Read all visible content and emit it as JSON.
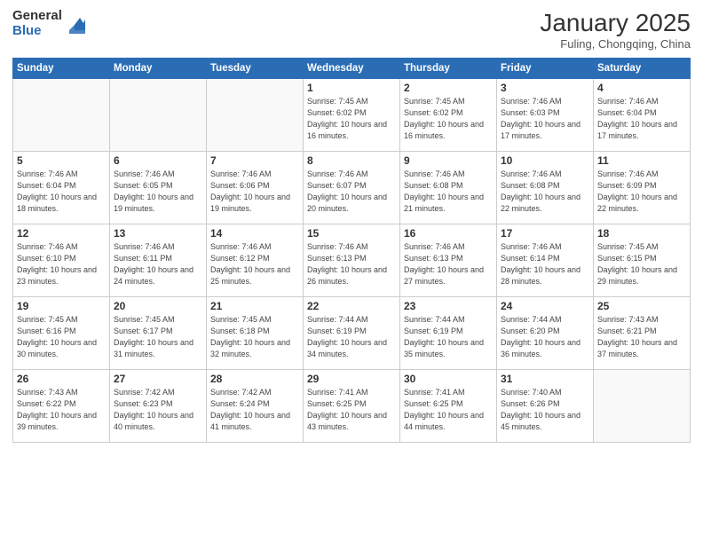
{
  "logo": {
    "general": "General",
    "blue": "Blue"
  },
  "header": {
    "month": "January 2025",
    "location": "Fuling, Chongqing, China"
  },
  "weekdays": [
    "Sunday",
    "Monday",
    "Tuesday",
    "Wednesday",
    "Thursday",
    "Friday",
    "Saturday"
  ],
  "weeks": [
    [
      {
        "day": "",
        "sunrise": "",
        "sunset": "",
        "daylight": ""
      },
      {
        "day": "",
        "sunrise": "",
        "sunset": "",
        "daylight": ""
      },
      {
        "day": "",
        "sunrise": "",
        "sunset": "",
        "daylight": ""
      },
      {
        "day": "1",
        "sunrise": "Sunrise: 7:45 AM",
        "sunset": "Sunset: 6:02 PM",
        "daylight": "Daylight: 10 hours and 16 minutes."
      },
      {
        "day": "2",
        "sunrise": "Sunrise: 7:45 AM",
        "sunset": "Sunset: 6:02 PM",
        "daylight": "Daylight: 10 hours and 16 minutes."
      },
      {
        "day": "3",
        "sunrise": "Sunrise: 7:46 AM",
        "sunset": "Sunset: 6:03 PM",
        "daylight": "Daylight: 10 hours and 17 minutes."
      },
      {
        "day": "4",
        "sunrise": "Sunrise: 7:46 AM",
        "sunset": "Sunset: 6:04 PM",
        "daylight": "Daylight: 10 hours and 17 minutes."
      }
    ],
    [
      {
        "day": "5",
        "sunrise": "Sunrise: 7:46 AM",
        "sunset": "Sunset: 6:04 PM",
        "daylight": "Daylight: 10 hours and 18 minutes."
      },
      {
        "day": "6",
        "sunrise": "Sunrise: 7:46 AM",
        "sunset": "Sunset: 6:05 PM",
        "daylight": "Daylight: 10 hours and 19 minutes."
      },
      {
        "day": "7",
        "sunrise": "Sunrise: 7:46 AM",
        "sunset": "Sunset: 6:06 PM",
        "daylight": "Daylight: 10 hours and 19 minutes."
      },
      {
        "day": "8",
        "sunrise": "Sunrise: 7:46 AM",
        "sunset": "Sunset: 6:07 PM",
        "daylight": "Daylight: 10 hours and 20 minutes."
      },
      {
        "day": "9",
        "sunrise": "Sunrise: 7:46 AM",
        "sunset": "Sunset: 6:08 PM",
        "daylight": "Daylight: 10 hours and 21 minutes."
      },
      {
        "day": "10",
        "sunrise": "Sunrise: 7:46 AM",
        "sunset": "Sunset: 6:08 PM",
        "daylight": "Daylight: 10 hours and 22 minutes."
      },
      {
        "day": "11",
        "sunrise": "Sunrise: 7:46 AM",
        "sunset": "Sunset: 6:09 PM",
        "daylight": "Daylight: 10 hours and 22 minutes."
      }
    ],
    [
      {
        "day": "12",
        "sunrise": "Sunrise: 7:46 AM",
        "sunset": "Sunset: 6:10 PM",
        "daylight": "Daylight: 10 hours and 23 minutes."
      },
      {
        "day": "13",
        "sunrise": "Sunrise: 7:46 AM",
        "sunset": "Sunset: 6:11 PM",
        "daylight": "Daylight: 10 hours and 24 minutes."
      },
      {
        "day": "14",
        "sunrise": "Sunrise: 7:46 AM",
        "sunset": "Sunset: 6:12 PM",
        "daylight": "Daylight: 10 hours and 25 minutes."
      },
      {
        "day": "15",
        "sunrise": "Sunrise: 7:46 AM",
        "sunset": "Sunset: 6:13 PM",
        "daylight": "Daylight: 10 hours and 26 minutes."
      },
      {
        "day": "16",
        "sunrise": "Sunrise: 7:46 AM",
        "sunset": "Sunset: 6:13 PM",
        "daylight": "Daylight: 10 hours and 27 minutes."
      },
      {
        "day": "17",
        "sunrise": "Sunrise: 7:46 AM",
        "sunset": "Sunset: 6:14 PM",
        "daylight": "Daylight: 10 hours and 28 minutes."
      },
      {
        "day": "18",
        "sunrise": "Sunrise: 7:45 AM",
        "sunset": "Sunset: 6:15 PM",
        "daylight": "Daylight: 10 hours and 29 minutes."
      }
    ],
    [
      {
        "day": "19",
        "sunrise": "Sunrise: 7:45 AM",
        "sunset": "Sunset: 6:16 PM",
        "daylight": "Daylight: 10 hours and 30 minutes."
      },
      {
        "day": "20",
        "sunrise": "Sunrise: 7:45 AM",
        "sunset": "Sunset: 6:17 PM",
        "daylight": "Daylight: 10 hours and 31 minutes."
      },
      {
        "day": "21",
        "sunrise": "Sunrise: 7:45 AM",
        "sunset": "Sunset: 6:18 PM",
        "daylight": "Daylight: 10 hours and 32 minutes."
      },
      {
        "day": "22",
        "sunrise": "Sunrise: 7:44 AM",
        "sunset": "Sunset: 6:19 PM",
        "daylight": "Daylight: 10 hours and 34 minutes."
      },
      {
        "day": "23",
        "sunrise": "Sunrise: 7:44 AM",
        "sunset": "Sunset: 6:19 PM",
        "daylight": "Daylight: 10 hours and 35 minutes."
      },
      {
        "day": "24",
        "sunrise": "Sunrise: 7:44 AM",
        "sunset": "Sunset: 6:20 PM",
        "daylight": "Daylight: 10 hours and 36 minutes."
      },
      {
        "day": "25",
        "sunrise": "Sunrise: 7:43 AM",
        "sunset": "Sunset: 6:21 PM",
        "daylight": "Daylight: 10 hours and 37 minutes."
      }
    ],
    [
      {
        "day": "26",
        "sunrise": "Sunrise: 7:43 AM",
        "sunset": "Sunset: 6:22 PM",
        "daylight": "Daylight: 10 hours and 39 minutes."
      },
      {
        "day": "27",
        "sunrise": "Sunrise: 7:42 AM",
        "sunset": "Sunset: 6:23 PM",
        "daylight": "Daylight: 10 hours and 40 minutes."
      },
      {
        "day": "28",
        "sunrise": "Sunrise: 7:42 AM",
        "sunset": "Sunset: 6:24 PM",
        "daylight": "Daylight: 10 hours and 41 minutes."
      },
      {
        "day": "29",
        "sunrise": "Sunrise: 7:41 AM",
        "sunset": "Sunset: 6:25 PM",
        "daylight": "Daylight: 10 hours and 43 minutes."
      },
      {
        "day": "30",
        "sunrise": "Sunrise: 7:41 AM",
        "sunset": "Sunset: 6:25 PM",
        "daylight": "Daylight: 10 hours and 44 minutes."
      },
      {
        "day": "31",
        "sunrise": "Sunrise: 7:40 AM",
        "sunset": "Sunset: 6:26 PM",
        "daylight": "Daylight: 10 hours and 45 minutes."
      },
      {
        "day": "",
        "sunrise": "",
        "sunset": "",
        "daylight": ""
      }
    ]
  ]
}
